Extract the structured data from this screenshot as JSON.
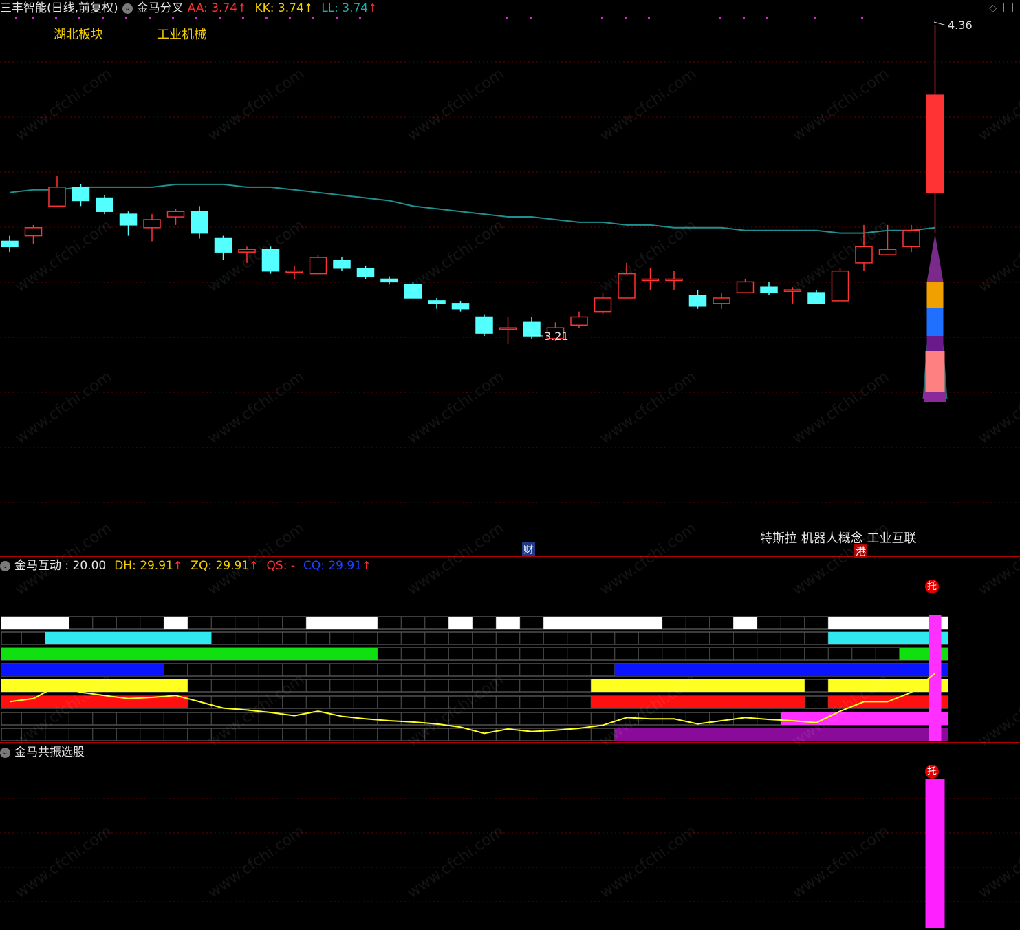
{
  "main_header": {
    "stock": "三丰智能(日线,前复权)",
    "indicator": "金马分叉",
    "aa": "AA: 3.74",
    "kk": "KK: 3.74",
    "ll": "LL: 3.74"
  },
  "tags": {
    "hubei": "湖北板块",
    "machinery": "工业机械"
  },
  "concepts": "特斯拉 机器人概念 工业互联",
  "markers": {
    "cai": "财",
    "gang": "港",
    "tuo": "托"
  },
  "price_high_label": "4.36",
  "price_low_label": "3.21",
  "sub1_header": {
    "name": "金马互动 : 20.00",
    "dh": "DH: 29.91",
    "zq": "ZQ: 29.91",
    "qs": "QS: -",
    "cq": "CQ: 29.91"
  },
  "sub2_header": {
    "name": "金马共振选股"
  },
  "watermark": "www.cfchi.com",
  "colors": {
    "up": "#ff3333",
    "down": "#54ffff",
    "ma": "#1f9090",
    "bg": "#000000"
  },
  "chart_data": {
    "type": "candlestick",
    "ylim": [
      2.85,
      4.45
    ],
    "candles": [
      [
        3.56,
        3.54,
        3.58,
        3.52
      ],
      [
        3.58,
        3.61,
        3.62,
        3.55
      ],
      [
        3.69,
        3.76,
        3.8,
        3.69
      ],
      [
        3.76,
        3.71,
        3.77,
        3.69
      ],
      [
        3.72,
        3.67,
        3.73,
        3.66
      ],
      [
        3.66,
        3.62,
        3.67,
        3.58
      ],
      [
        3.61,
        3.64,
        3.66,
        3.56
      ],
      [
        3.65,
        3.67,
        3.68,
        3.62
      ],
      [
        3.67,
        3.59,
        3.69,
        3.57
      ],
      [
        3.57,
        3.52,
        3.58,
        3.49
      ],
      [
        3.52,
        3.53,
        3.54,
        3.48
      ],
      [
        3.53,
        3.45,
        3.54,
        3.44
      ],
      [
        3.45,
        3.45,
        3.47,
        3.42
      ],
      [
        3.44,
        3.5,
        3.51,
        3.44
      ],
      [
        3.49,
        3.46,
        3.5,
        3.45
      ],
      [
        3.46,
        3.43,
        3.47,
        3.42
      ],
      [
        3.42,
        3.41,
        3.43,
        3.4
      ],
      [
        3.4,
        3.35,
        3.41,
        3.35
      ],
      [
        3.34,
        3.33,
        3.35,
        3.31
      ],
      [
        3.33,
        3.31,
        3.34,
        3.3
      ],
      [
        3.28,
        3.22,
        3.29,
        3.21
      ],
      [
        3.24,
        3.24,
        3.28,
        3.18
      ],
      [
        3.26,
        3.21,
        3.28,
        3.2
      ],
      [
        3.2,
        3.24,
        3.26,
        3.19
      ],
      [
        3.25,
        3.28,
        3.3,
        3.24
      ],
      [
        3.3,
        3.35,
        3.37,
        3.29
      ],
      [
        3.35,
        3.44,
        3.48,
        3.35
      ],
      [
        3.42,
        3.42,
        3.46,
        3.38
      ],
      [
        3.42,
        3.42,
        3.45,
        3.38
      ],
      [
        3.36,
        3.32,
        3.38,
        3.31
      ],
      [
        3.33,
        3.35,
        3.37,
        3.31
      ],
      [
        3.37,
        3.41,
        3.42,
        3.37
      ],
      [
        3.39,
        3.37,
        3.41,
        3.36
      ],
      [
        3.38,
        3.38,
        3.39,
        3.33
      ],
      [
        3.37,
        3.33,
        3.38,
        3.33
      ],
      [
        3.34,
        3.45,
        3.46,
        3.34
      ],
      [
        3.48,
        3.54,
        3.62,
        3.45
      ],
      [
        3.51,
        3.53,
        3.62,
        3.51
      ],
      [
        3.54,
        3.6,
        3.62,
        3.52
      ],
      [
        3.74,
        4.1,
        4.36,
        3.59
      ]
    ],
    "ma": [
      3.74,
      3.75,
      3.75,
      3.76,
      3.76,
      3.76,
      3.76,
      3.77,
      3.77,
      3.77,
      3.76,
      3.76,
      3.75,
      3.74,
      3.73,
      3.72,
      3.71,
      3.69,
      3.68,
      3.67,
      3.66,
      3.65,
      3.65,
      3.64,
      3.63,
      3.63,
      3.62,
      3.62,
      3.61,
      3.61,
      3.61,
      3.6,
      3.6,
      3.6,
      3.6,
      3.59,
      3.59,
      3.6,
      3.6,
      3.61
    ],
    "resonance_line": [
      0.55,
      0.6,
      0.8,
      0.7,
      0.65,
      0.6,
      0.62,
      0.65,
      0.55,
      0.45,
      0.42,
      0.38,
      0.33,
      0.4,
      0.32,
      0.28,
      0.25,
      0.23,
      0.2,
      0.15,
      0.05,
      0.12,
      0.08,
      0.1,
      0.13,
      0.18,
      0.3,
      0.28,
      0.28,
      0.2,
      0.25,
      0.3,
      0.27,
      0.25,
      0.22,
      0.4,
      0.55,
      0.55,
      0.7,
      1.0
    ]
  }
}
